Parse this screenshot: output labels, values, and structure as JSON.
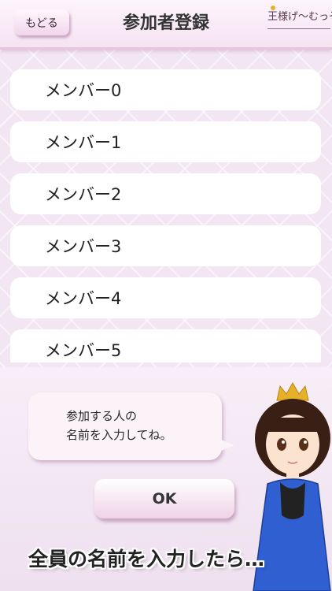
{
  "header": {
    "back_label": "もどる",
    "title": "参加者登録",
    "logo_text": "王様げ〜むっぞ"
  },
  "members": [
    {
      "label": "メンバー0"
    },
    {
      "label": "メンバー1"
    },
    {
      "label": "メンバー2"
    },
    {
      "label": "メンバー3"
    },
    {
      "label": "メンバー4"
    },
    {
      "label": "メンバー5"
    }
  ],
  "bubble": {
    "line1": "参加する人の",
    "line2": "名前を入力してね。"
  },
  "ok_label": "OK",
  "caption": "全員の名前を入力したら…",
  "character": {
    "icon": "princess-character"
  },
  "colors": {
    "background": "#f2e6f2",
    "header_border": "#e7c3df",
    "crown": "#e7b02a",
    "dress": "#2f5fd0"
  }
}
